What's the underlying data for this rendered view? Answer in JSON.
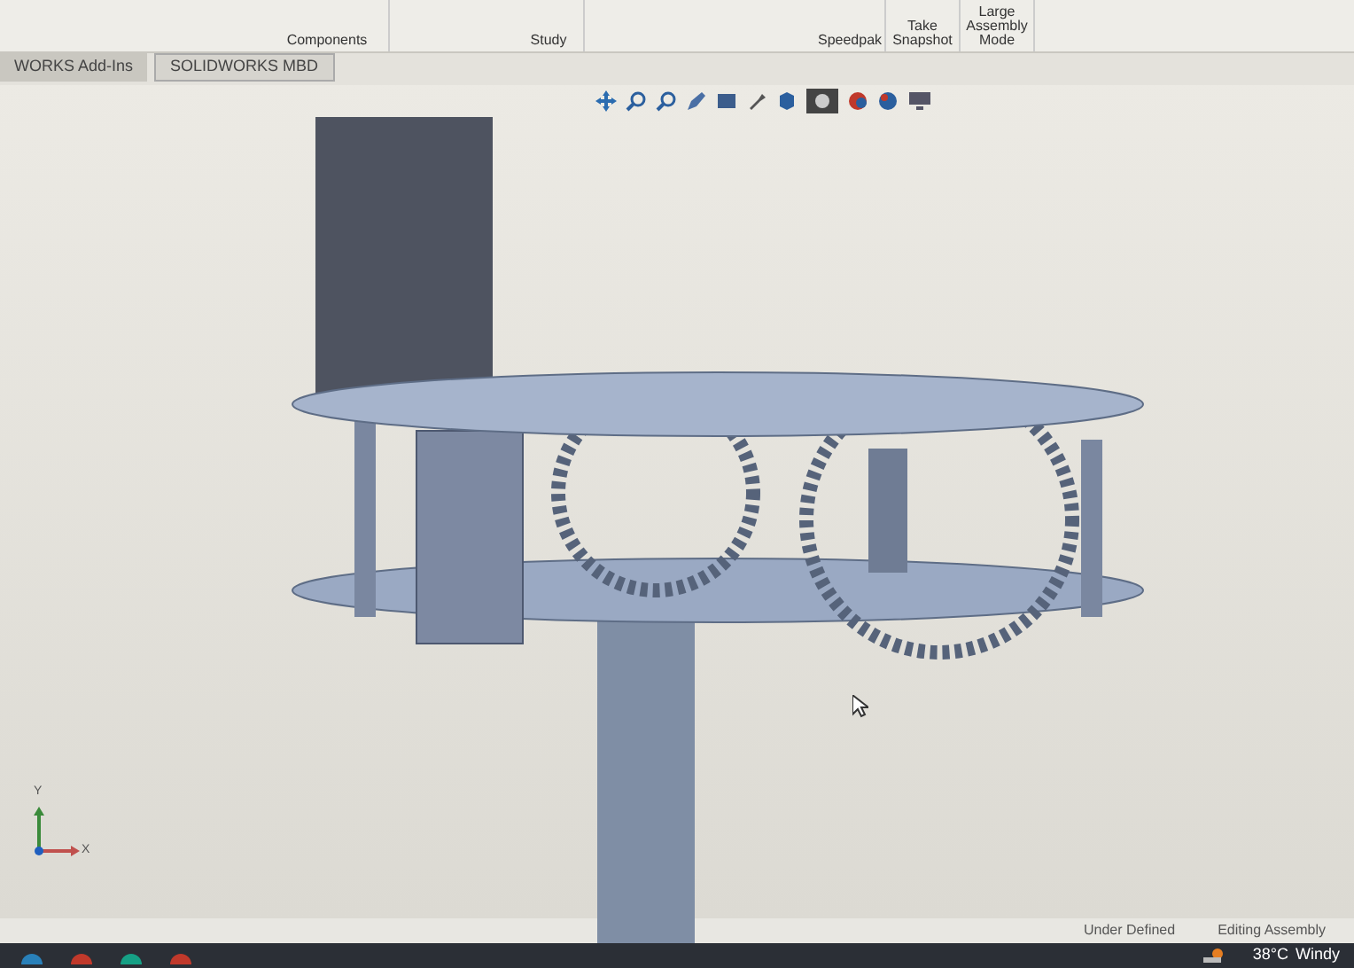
{
  "ribbon": {
    "buttons": [
      {
        "label": "Components"
      },
      {
        "label": "Study"
      },
      {
        "label": "Speedpak"
      },
      {
        "label": "Take Snapshot"
      },
      {
        "label": "Large Assembly Mode"
      }
    ]
  },
  "tabs": [
    {
      "label": "WORKS Add-Ins",
      "selected": false
    },
    {
      "label": "SOLIDWORKS MBD",
      "selected": true
    }
  ],
  "triad": {
    "y_label": "Y",
    "x_label": "X"
  },
  "status_bar": {
    "items": [
      "Under Defined",
      "Editing Assembly"
    ]
  },
  "taskbar": {
    "temperature": "38°C",
    "weather": "Windy"
  }
}
